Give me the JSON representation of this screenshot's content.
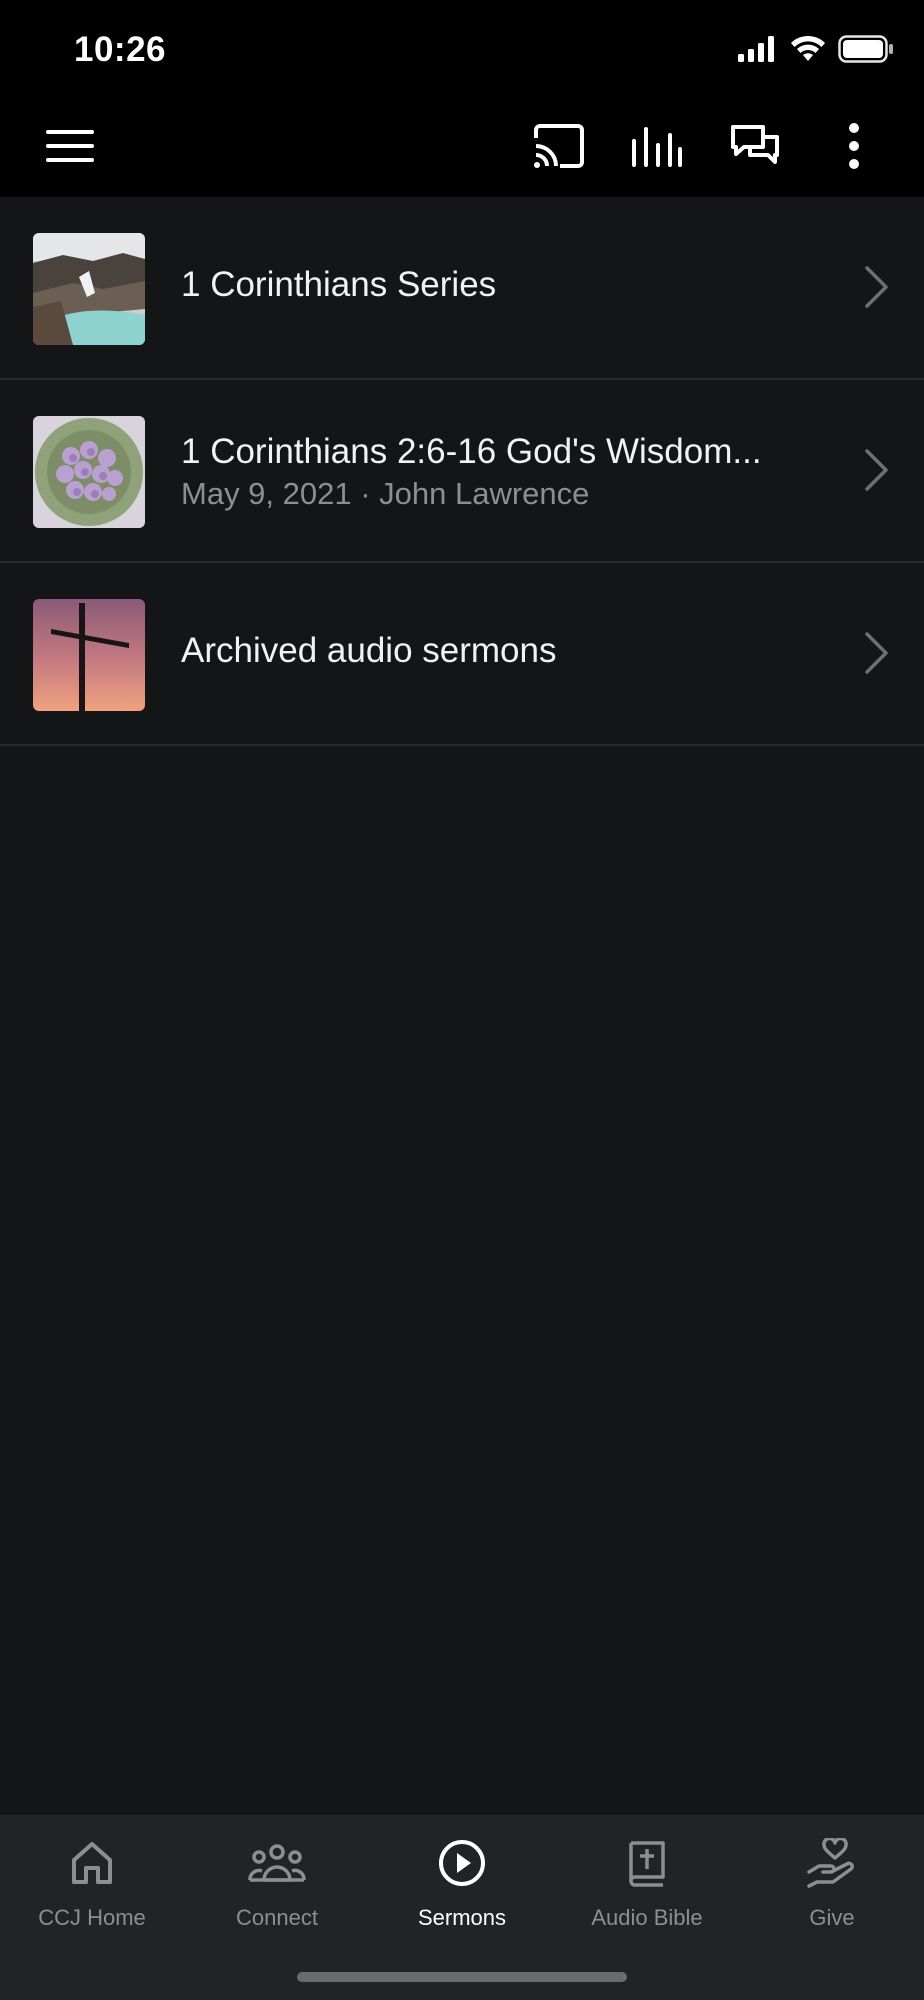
{
  "status_bar": {
    "time": "10:26"
  },
  "toolbar": {
    "icons": [
      "menu-icon",
      "cast-icon",
      "audio-bars-icon",
      "chat-icon",
      "more-vertical-icon"
    ]
  },
  "list": {
    "items": [
      {
        "title": "1 Corinthians Series",
        "subtitle": "",
        "thumb": "landscape-lake-image"
      },
      {
        "title": "1 Corinthians 2:6-16   God's Wisdom...",
        "subtitle": "May 9, 2021 · John Lawrence",
        "thumb": "flowers-bouquet-image"
      },
      {
        "title": "Archived audio sermons",
        "subtitle": "",
        "thumb": "cross-sunset-image"
      }
    ]
  },
  "bottom_nav": {
    "items": [
      {
        "label": "CCJ Home",
        "icon": "home-icon",
        "active": false
      },
      {
        "label": "Connect",
        "icon": "people-icon",
        "active": false
      },
      {
        "label": "Sermons",
        "icon": "play-circle-icon",
        "active": true
      },
      {
        "label": "Audio Bible",
        "icon": "bible-icon",
        "active": false
      },
      {
        "label": "Give",
        "icon": "give-hand-icon",
        "active": false
      }
    ]
  },
  "colors": {
    "background": "#141517",
    "bars": "#000000",
    "nav_bg": "#222326",
    "muted": "#8d8e92"
  }
}
